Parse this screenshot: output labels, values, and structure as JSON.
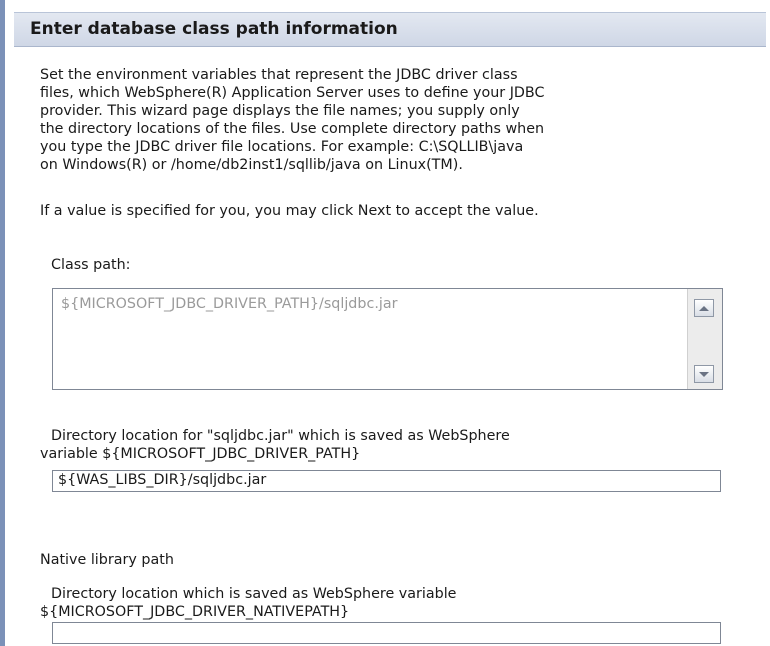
{
  "header": {
    "title": "Enter database class path information"
  },
  "intro": {
    "text": "Set the environment variables that represent the JDBC driver class\nfiles, which WebSphere(R) Application Server uses to define your JDBC\nprovider. This wizard page displays the file names; you supply only\nthe directory locations of the files. Use complete directory paths when\nyou type the JDBC driver file locations. For example: C:\\SQLLIB\\java\non Windows(R) or /home/db2inst1/sqllib/java on Linux(TM).",
    "hint": "If a value is specified for you, you may click Next to accept the value."
  },
  "class_path": {
    "label": "Class path:",
    "value": "${MICROSOFT_JDBC_DRIVER_PATH}/sqljdbc.jar"
  },
  "directory_location": {
    "label_line1": "Directory location for \"sqljdbc.jar\" which is saved as WebSphere",
    "label_line2": "variable ${MICROSOFT_JDBC_DRIVER_PATH}",
    "value": "${WAS_LIBS_DIR}/sqljdbc.jar"
  },
  "native_library": {
    "section_label": "Native library path",
    "label_line1": "Directory location which is saved as WebSphere variable",
    "label_line2": "${MICROSOFT_JDBC_DRIVER_NATIVEPATH}",
    "value": ""
  },
  "colors": {
    "header_bg": "#d6dded",
    "left_rule": "#7b91b8",
    "disabled_text": "#9a9a9a"
  }
}
